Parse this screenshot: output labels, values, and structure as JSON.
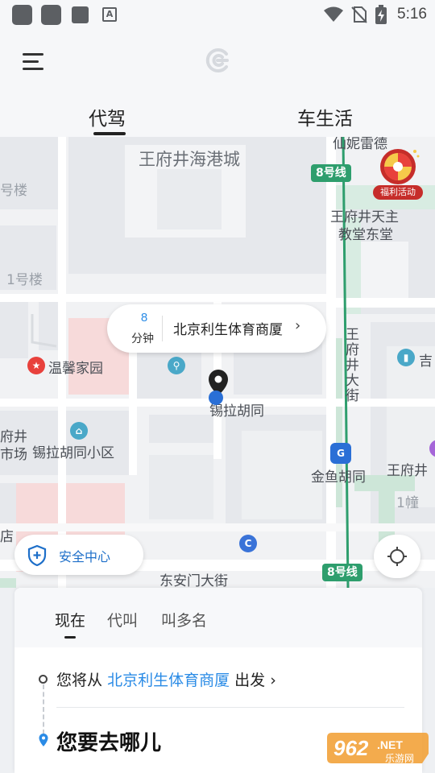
{
  "status_bar": {
    "time": "5:16",
    "notification_icons": [
      "app-icon",
      "app-icon",
      "app-icon",
      "font-icon"
    ],
    "font_icon_text": "A"
  },
  "header": {
    "tabs": [
      {
        "label": "代驾",
        "active": true
      },
      {
        "label": "车生活",
        "active": false
      }
    ]
  },
  "map": {
    "labels": {
      "wangfujing_haigang": "王府井海港城",
      "xiannisi": "仙妮雷德",
      "building_1": "1号楼",
      "building_h": "号楼",
      "wenxin": "温馨家园",
      "xilahutong": "锡拉胡同",
      "xilahutong_xiaoqu": "锡拉胡同小区",
      "fujing": "府井",
      "shichang": "市场",
      "jinyuhutong": "金鱼胡同",
      "wangfujing_church_1": "王府井天主",
      "wangfujing_church_2": "教堂东堂",
      "wangfujing_dajie": "王府井大街",
      "wangfujing_right": "王府井",
      "ji": "吉",
      "chuang1": "1幢",
      "dongan": "东安门大街",
      "dian": "店"
    },
    "metro_tags": [
      "8号线",
      "8号线"
    ],
    "pickup_bubble": {
      "minutes": "8",
      "unit": "分钟",
      "place": "北京利生体育商厦",
      "arrow": "›"
    },
    "welfare_label": "福利活动",
    "safety_center": "安全中心"
  },
  "panel": {
    "tabs": [
      {
        "label": "现在",
        "active": true
      },
      {
        "label": "代叫",
        "active": false
      },
      {
        "label": "叫多名",
        "active": false
      }
    ],
    "from_prefix": "您将从",
    "from_location": "北京利生体育商厦",
    "from_suffix": "出发",
    "from_arrow": "›",
    "destination_placeholder": "您要去哪儿"
  },
  "watermark": {
    "number": "962",
    "suffix": ".NET",
    "site": "乐游网"
  },
  "colors": {
    "accent_blue": "#2a8be6",
    "metro_green": "#2e9e6d",
    "poi_red": "#e8413c",
    "poi_teal": "#4aa8c8",
    "welfare_red": "#c62d2a"
  }
}
